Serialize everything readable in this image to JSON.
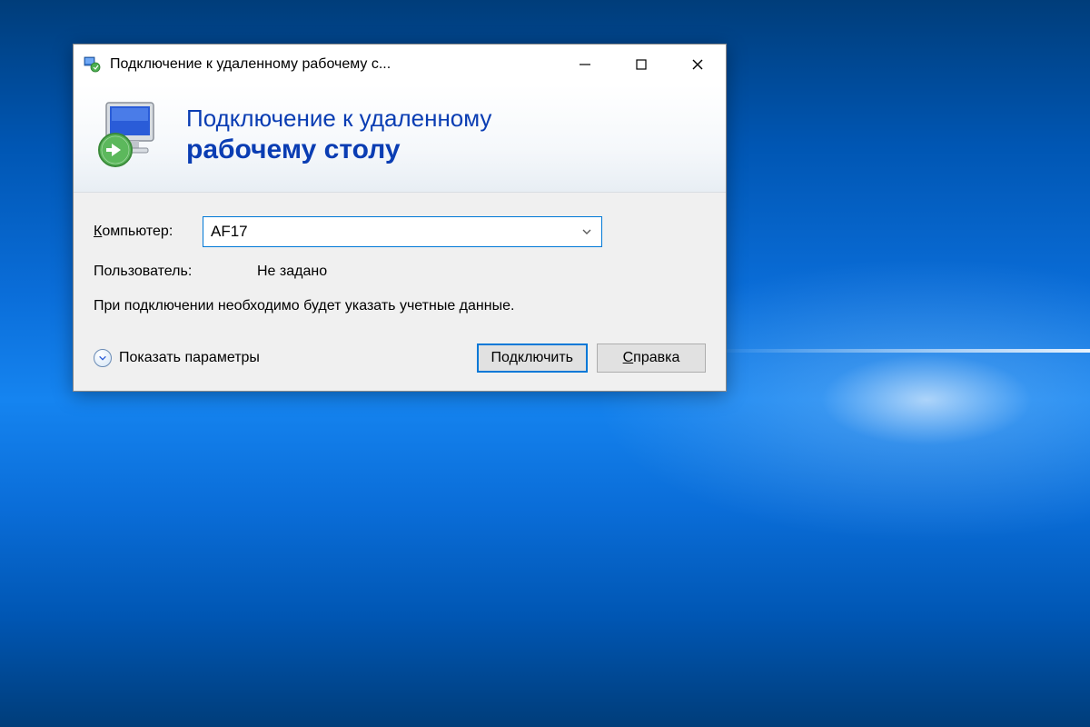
{
  "window": {
    "title": "Подключение к удаленному рабочему с..."
  },
  "header": {
    "line1": "Подключение к удаленному",
    "line2": "рабочему столу"
  },
  "form": {
    "computer_label_pre": "К",
    "computer_label_rest": "омпьютер:",
    "computer_value": "AF17",
    "user_label": "Пользователь:",
    "user_value": "Не задано",
    "info": "При подключении необходимо будет указать учетные данные."
  },
  "footer": {
    "show_params_pre": "П",
    "show_params_rest": "оказать параметры",
    "connect_label": "Подключить",
    "help_pre": "С",
    "help_rest": "правка"
  }
}
